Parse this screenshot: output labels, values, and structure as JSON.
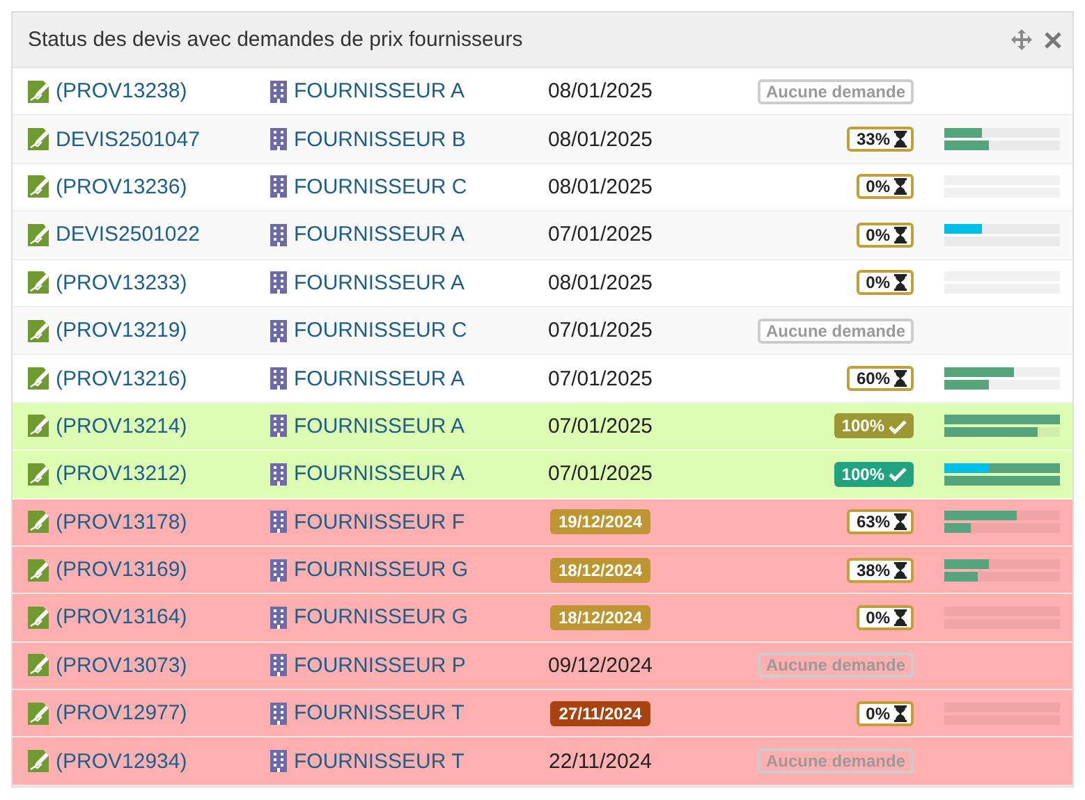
{
  "panel": {
    "title": "Status des devis avec demandes de prix fournisseurs"
  },
  "rows": [
    {
      "kind": "default",
      "ref": "(PROV13238)",
      "supplier": "FOURNISSEUR A",
      "date": {
        "text": "08/01/2025",
        "kind": "plain"
      },
      "status": {
        "kind": "none",
        "text": "Aucune demande"
      }
    },
    {
      "kind": "default",
      "ref": "DEVIS2501047",
      "supplier": "FOURNISSEUR B",
      "date": {
        "text": "08/01/2025",
        "kind": "plain"
      },
      "status": {
        "kind": "pending",
        "text": "33%"
      },
      "tracks": [
        {
          "segments": [
            {
              "level": 0.33,
              "color": "#55a47e"
            }
          ]
        },
        {
          "segments": [
            {
              "level": 0.39,
              "color": "#55a47e"
            }
          ]
        }
      ]
    },
    {
      "kind": "default",
      "ref": "(PROV13236)",
      "supplier": "FOURNISSEUR C",
      "date": {
        "text": "08/01/2025",
        "kind": "plain"
      },
      "status": {
        "kind": "pending",
        "text": "0%"
      },
      "tracks": [
        {
          "kind": "empty"
        },
        {
          "kind": "empty"
        }
      ]
    },
    {
      "kind": "default",
      "ref": "DEVIS2501022",
      "supplier": "FOURNISSEUR A",
      "date": {
        "text": "07/01/2025",
        "kind": "plain"
      },
      "status": {
        "kind": "pending",
        "text": "0%"
      },
      "tracks": [
        {
          "segments": [
            {
              "level": 0.33,
              "color": "#00bfe7"
            }
          ]
        },
        {
          "kind": "empty"
        }
      ]
    },
    {
      "kind": "default",
      "ref": "(PROV13233)",
      "supplier": "FOURNISSEUR A",
      "date": {
        "text": "08/01/2025",
        "kind": "plain"
      },
      "status": {
        "kind": "pending",
        "text": "0%"
      },
      "tracks": [
        {
          "kind": "empty"
        },
        {
          "kind": "empty"
        }
      ]
    },
    {
      "kind": "default",
      "ref": "(PROV13219)",
      "supplier": "FOURNISSEUR C",
      "date": {
        "text": "07/01/2025",
        "kind": "plain"
      },
      "status": {
        "kind": "none",
        "text": "Aucune demande"
      }
    },
    {
      "kind": "default",
      "ref": "(PROV13216)",
      "supplier": "FOURNISSEUR A",
      "date": {
        "text": "07/01/2025",
        "kind": "plain"
      },
      "status": {
        "kind": "pending",
        "text": "60%"
      },
      "tracks": [
        {
          "segments": [
            {
              "level": 0.6,
              "color": "#55a47e"
            }
          ]
        },
        {
          "segments": [
            {
              "level": 0.39,
              "color": "#55a47e"
            }
          ]
        }
      ]
    },
    {
      "kind": "success",
      "ref": "(PROV13214)",
      "supplier": "FOURNISSEUR A",
      "date": {
        "text": "07/01/2025",
        "kind": "plain"
      },
      "status": {
        "kind": "done",
        "text": "100%"
      },
      "tracks": [
        {
          "segments": [
            {
              "level": 1,
              "color": "#55a47e"
            }
          ]
        },
        {
          "segments": [
            {
              "level": 0.81,
              "color": "#55a47e"
            }
          ]
        }
      ]
    },
    {
      "kind": "success",
      "ref": "(PROV13212)",
      "supplier": "FOURNISSEUR A",
      "date": {
        "text": "07/01/2025",
        "kind": "plain"
      },
      "status": {
        "kind": "done-alt",
        "text": "100%"
      },
      "tracks": [
        {
          "segments": [
            {
              "level": 0.39,
              "color": "#00bfe7"
            },
            {
              "level": 0.61,
              "color": "#55a47e"
            }
          ]
        },
        {
          "segments": [
            {
              "level": 1,
              "color": "#55a47e"
            }
          ]
        }
      ]
    },
    {
      "kind": "danger",
      "ref": "(PROV13178)",
      "supplier": "FOURNISSEUR F",
      "date": {
        "text": "19/12/2024",
        "kind": "warning"
      },
      "status": {
        "kind": "pending",
        "text": "63%"
      },
      "tracks": [
        {
          "segments": [
            {
              "level": 0.63,
              "color": "#55a47e"
            }
          ]
        },
        {
          "segments": [
            {
              "level": 0.23,
              "color": "#55a47e"
            }
          ]
        }
      ]
    },
    {
      "kind": "danger",
      "ref": "(PROV13169)",
      "supplier": "FOURNISSEUR G",
      "date": {
        "text": "18/12/2024",
        "kind": "warning"
      },
      "status": {
        "kind": "pending",
        "text": "38%"
      },
      "tracks": [
        {
          "segments": [
            {
              "level": 0.39,
              "color": "#55a47e"
            }
          ]
        },
        {
          "segments": [
            {
              "level": 0.29,
              "color": "#55a47e"
            }
          ]
        }
      ]
    },
    {
      "kind": "danger",
      "ref": "(PROV13164)",
      "supplier": "FOURNISSEUR G",
      "date": {
        "text": "18/12/2024",
        "kind": "warning"
      },
      "status": {
        "kind": "pending",
        "text": "0%"
      },
      "tracks": [
        {
          "kind": "empty"
        },
        {
          "kind": "empty"
        }
      ]
    },
    {
      "kind": "danger",
      "ref": "(PROV13073)",
      "supplier": "FOURNISSEUR P",
      "date": {
        "text": "09/12/2024",
        "kind": "plain"
      },
      "status": {
        "kind": "none",
        "text": "Aucune demande"
      }
    },
    {
      "kind": "danger",
      "ref": "(PROV12977)",
      "supplier": "FOURNISSEUR T",
      "date": {
        "text": "27/11/2024",
        "kind": "danger"
      },
      "status": {
        "kind": "pending",
        "text": "0%"
      },
      "tracks": [
        {
          "kind": "empty"
        },
        {
          "kind": "empty"
        }
      ]
    },
    {
      "kind": "danger",
      "ref": "(PROV12934)",
      "supplier": "FOURNISSEUR T",
      "date": {
        "text": "22/11/2024",
        "kind": "plain"
      },
      "status": {
        "kind": "none",
        "text": "Aucune demande"
      }
    }
  ]
}
